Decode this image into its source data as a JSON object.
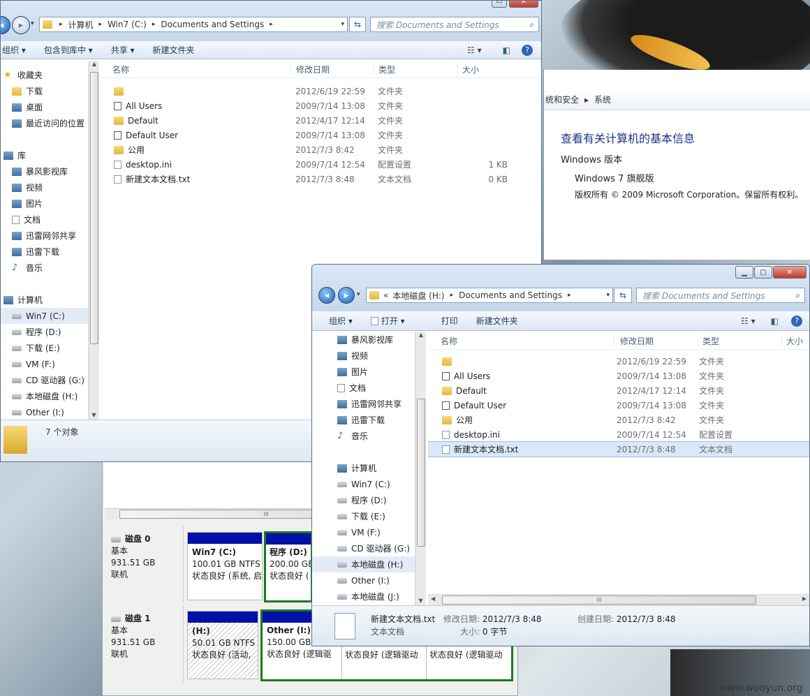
{
  "desktop": {
    "watermark": "www.wooyun.org"
  },
  "system_window": {
    "breadcrumb": [
      "统和安全",
      "系统"
    ],
    "heading": "查看有关计算机的基本信息",
    "section": "Windows 版本",
    "edition": "Windows 7 旗舰版",
    "copyright": "版权所有 © 2009 Microsoft Corporation。保留所有权利。"
  },
  "disk_mgmt": {
    "scroll_mark": "III",
    "disks": [
      {
        "name": "磁盘 0",
        "type": "基本",
        "size": "931.51 GB",
        "status": "联机",
        "parts": [
          {
            "title": "Win7  (C:)",
            "size": "100.01 GB NTFS",
            "status": "状态良好 (系统, 启"
          },
          {
            "title": "程序  (D:)",
            "size": "200.00 GB",
            "status": "状态良好 ("
          }
        ]
      },
      {
        "name": "磁盘 1",
        "type": "基本",
        "size": "931.51 GB",
        "status": "联机",
        "parts": [
          {
            "title": " (H:)",
            "size": "50.01 GB NTFS",
            "status": "状态良好 (活动,"
          },
          {
            "title": "Other  (I:)",
            "size": "150.00 GB",
            "status": "状态良好 (逻辑驱"
          },
          {
            "title": "",
            "size": "",
            "status": "状态良好 (逻辑驱动"
          },
          {
            "title": "",
            "size": "",
            "status": "状态良好 (逻辑驱动"
          }
        ]
      }
    ]
  },
  "explorer1": {
    "address": [
      "计算机",
      "Win7 (C:)",
      "Documents and Settings"
    ],
    "search_placeholder": "搜索 Documents and Settings",
    "toolbar": [
      "组织 ▾",
      "包含到库中 ▾",
      "共享 ▾",
      "新建文件夹"
    ],
    "nav": [
      {
        "label": "收藏夹",
        "icon": "star-icon",
        "indent": 0
      },
      {
        "label": "下载",
        "icon": "download-folder-icon",
        "indent": 1
      },
      {
        "label": "桌面",
        "icon": "desktop-icon",
        "indent": 1
      },
      {
        "label": "最近访问的位置",
        "icon": "recent-places-icon",
        "indent": 1
      },
      {
        "label": "",
        "icon": "",
        "indent": 0
      },
      {
        "label": "库",
        "icon": "library-icon",
        "indent": 0
      },
      {
        "label": "暴风影视库",
        "icon": "library-icon",
        "indent": 1
      },
      {
        "label": "视频",
        "icon": "video-icon",
        "indent": 1
      },
      {
        "label": "图片",
        "icon": "picture-icon",
        "indent": 1
      },
      {
        "label": "文档",
        "icon": "document-icon",
        "indent": 1
      },
      {
        "label": "迅雷网邻共享",
        "icon": "library-icon",
        "indent": 1
      },
      {
        "label": "迅雷下载",
        "icon": "library-icon",
        "indent": 1
      },
      {
        "label": "音乐",
        "icon": "music-icon",
        "indent": 1
      },
      {
        "label": "",
        "icon": "",
        "indent": 0
      },
      {
        "label": "计算机",
        "icon": "computer-icon",
        "indent": 0
      },
      {
        "label": "Win7 (C:)",
        "icon": "drive-icon",
        "indent": 1
      },
      {
        "label": "程序 (D:)",
        "icon": "drive-icon",
        "indent": 1
      },
      {
        "label": "下载 (E:)",
        "icon": "drive-icon",
        "indent": 1
      },
      {
        "label": "VM (F:)",
        "icon": "drive-icon",
        "indent": 1
      },
      {
        "label": "CD 驱动器 (G:)",
        "icon": "cd-drive-icon",
        "indent": 1
      },
      {
        "label": "本地磁盘 (H:)",
        "icon": "drive-icon",
        "indent": 1
      },
      {
        "label": "Other (I:)",
        "icon": "drive-icon",
        "indent": 1
      }
    ],
    "columns": [
      "名称",
      "修改日期",
      "类型",
      "大小"
    ],
    "files": [
      {
        "name": "",
        "date": "2012/6/19 22:59",
        "type": "文件夹",
        "size": "",
        "icon": "folder-icon"
      },
      {
        "name": "All Users",
        "date": "2009/7/14 13:08",
        "type": "文件夹",
        "size": "",
        "icon": "shortcut-icon"
      },
      {
        "name": "Default",
        "date": "2012/4/17 12:14",
        "type": "文件夹",
        "size": "",
        "icon": "folder-icon"
      },
      {
        "name": "Default User",
        "date": "2009/7/14 13:08",
        "type": "文件夹",
        "size": "",
        "icon": "shortcut-icon"
      },
      {
        "name": "公用",
        "date": "2012/7/3 8:42",
        "type": "文件夹",
        "size": "",
        "icon": "folder-icon"
      },
      {
        "name": "desktop.ini",
        "date": "2009/7/14 12:54",
        "type": "配置设置",
        "size": "1 KB",
        "icon": "settings-file-icon"
      },
      {
        "name": "新建文本文档.txt",
        "date": "2012/7/3 8:48",
        "type": "文本文档",
        "size": "0 KB",
        "icon": "text-file-icon"
      }
    ],
    "status": "7 个对象"
  },
  "explorer2": {
    "address": [
      "«",
      "本地磁盘 (H:)",
      "Documents and Settings"
    ],
    "search_placeholder": "搜索 Documents and Settings",
    "toolbar": [
      "组织 ▾",
      "打开 ▾",
      "打印",
      "新建文件夹"
    ],
    "nav": [
      {
        "label": "暴风影视库",
        "icon": "library-icon"
      },
      {
        "label": "视频",
        "icon": "video-icon"
      },
      {
        "label": "图片",
        "icon": "picture-icon"
      },
      {
        "label": "文档",
        "icon": "document-icon"
      },
      {
        "label": "迅雷网邻共享",
        "icon": "library-icon"
      },
      {
        "label": "迅雷下载",
        "icon": "library-icon"
      },
      {
        "label": "音乐",
        "icon": "music-icon"
      },
      {
        "label": "",
        "icon": ""
      },
      {
        "label": "计算机",
        "icon": "computer-icon"
      },
      {
        "label": "Win7 (C:)",
        "icon": "drive-icon"
      },
      {
        "label": "程序 (D:)",
        "icon": "drive-icon"
      },
      {
        "label": "下载 (E:)",
        "icon": "drive-icon"
      },
      {
        "label": "VM (F:)",
        "icon": "drive-icon"
      },
      {
        "label": "CD 驱动器 (G:)",
        "icon": "cd-drive-icon"
      },
      {
        "label": "本地磁盘 (H:)",
        "icon": "drive-icon"
      },
      {
        "label": "Other (I:)",
        "icon": "drive-icon"
      },
      {
        "label": "本地磁盘 (J:)",
        "icon": "drive-icon"
      }
    ],
    "columns": [
      "名称",
      "修改日期",
      "类型",
      "大小"
    ],
    "files": [
      {
        "name": "",
        "date": "2012/6/19 22:59",
        "type": "文件夹",
        "icon": "folder-icon"
      },
      {
        "name": "All Users",
        "date": "2009/7/14 13:08",
        "type": "文件夹",
        "icon": "shortcut-icon"
      },
      {
        "name": "Default",
        "date": "2012/4/17 12:14",
        "type": "文件夹",
        "icon": "folder-icon"
      },
      {
        "name": "Default User",
        "date": "2009/7/14 13:08",
        "type": "文件夹",
        "icon": "shortcut-icon"
      },
      {
        "name": "公用",
        "date": "2012/7/3 8:42",
        "type": "文件夹",
        "icon": "folder-icon"
      },
      {
        "name": "desktop.ini",
        "date": "2009/7/14 12:54",
        "type": "配置设置",
        "icon": "settings-file-icon"
      },
      {
        "name": "新建文本文档.txt",
        "date": "2012/7/3 8:48",
        "type": "文本文档",
        "icon": "text-file-icon",
        "selected": true
      }
    ],
    "hscroll_mark": "III",
    "details": {
      "filename": "新建文本文档.txt",
      "modified_label": "修改日期:",
      "modified": "2012/7/3 8:48",
      "created_label": "创建日期:",
      "created": "2012/7/3 8:48",
      "type": "文本文档",
      "size_label": "大小:",
      "size": "0 字节"
    }
  }
}
